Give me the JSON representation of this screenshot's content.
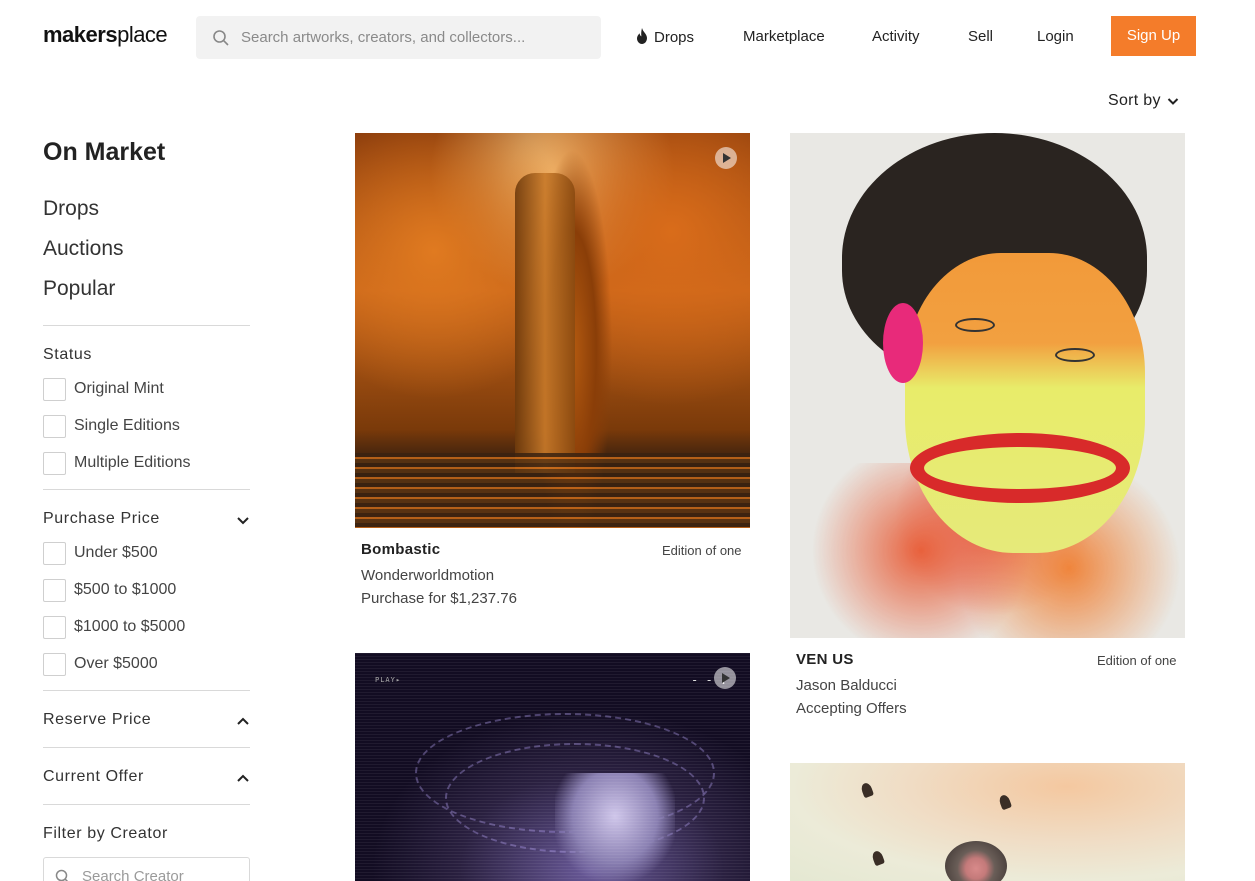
{
  "header": {
    "logo_bold": "makers",
    "logo_light": "place",
    "search_placeholder": "Search artworks, creators, and collectors...",
    "nav": {
      "drops": "Drops",
      "marketplace": "Marketplace",
      "activity": "Activity",
      "sell": "Sell",
      "login": "Login",
      "signup": "Sign Up"
    },
    "signup_color": "#f47c2a"
  },
  "sort": {
    "label": "Sort by"
  },
  "sidebar": {
    "title": "On Market",
    "links": [
      "Drops",
      "Auctions",
      "Popular"
    ],
    "status": {
      "title": "Status",
      "options": [
        "Original Mint",
        "Single Editions",
        "Multiple Editions"
      ]
    },
    "purchase_price": {
      "title": "Purchase Price",
      "options": [
        "Under $500",
        "$500 to $1000",
        "$1000 to $5000",
        "Over $5000"
      ]
    },
    "reserve_price": {
      "title": "Reserve Price"
    },
    "current_offer": {
      "title": "Current Offer"
    },
    "filter_creator": {
      "title": "Filter by Creator",
      "placeholder": "Search Creator"
    }
  },
  "cards": [
    {
      "title": "Bombastic",
      "edition": "Edition of one",
      "creator": "Wonderworldmotion",
      "price": "Purchase for $1,237.76"
    },
    {
      "title": "VEN US",
      "edition": "Edition of one",
      "creator": "Jason Balducci",
      "price": "Accepting Offers"
    }
  ],
  "art3_overlay": {
    "play_text": "PLAY▸",
    "timecode": "- - :"
  }
}
